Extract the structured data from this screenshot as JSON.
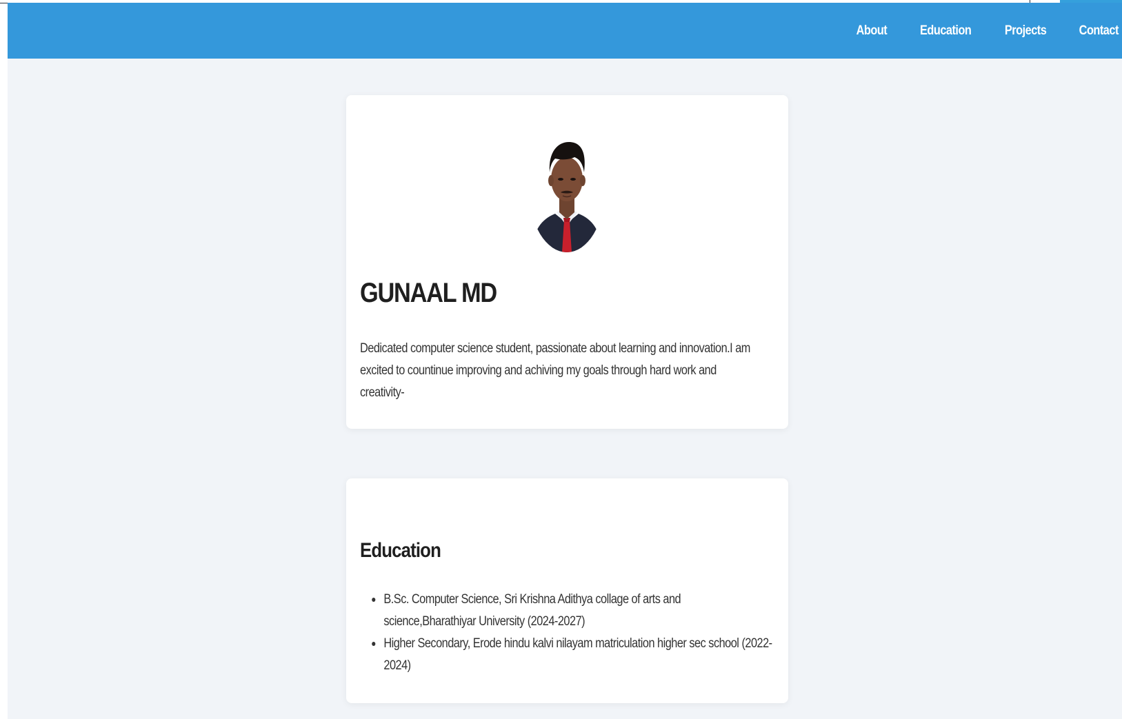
{
  "nav": {
    "items": [
      "About",
      "Education",
      "Projects",
      "Contact"
    ]
  },
  "profile": {
    "name": "GUNAAL MD",
    "bio": "Dedicated computer science student, passionate about learning and innovation.I am excited to countinue improving and achiving my goals through hard work and creativity-"
  },
  "education": {
    "title": "Education",
    "items": [
      "B.Sc. Computer Science, Sri Krishna Adithya collage of arts and science,Bharathiyar University (2024-2027)",
      "Higher Secondary, Erode hindu kalvi nilayam matriculation higher sec school (2022-2024)"
    ]
  },
  "colors": {
    "navbar": "#3498db",
    "background": "#f1f4f8",
    "card": "#ffffff"
  }
}
